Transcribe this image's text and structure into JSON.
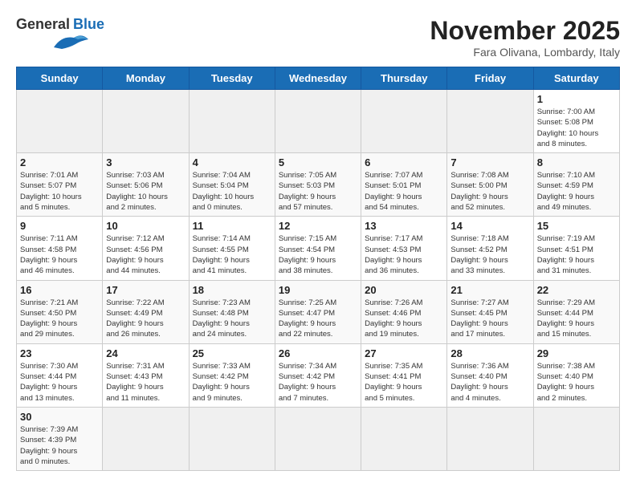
{
  "logo": {
    "text_general": "General",
    "text_blue": "Blue"
  },
  "title": "November 2025",
  "subtitle": "Fara Olivana, Lombardy, Italy",
  "days_of_week": [
    "Sunday",
    "Monday",
    "Tuesday",
    "Wednesday",
    "Thursday",
    "Friday",
    "Saturday"
  ],
  "weeks": [
    [
      {
        "day": "",
        "info": ""
      },
      {
        "day": "",
        "info": ""
      },
      {
        "day": "",
        "info": ""
      },
      {
        "day": "",
        "info": ""
      },
      {
        "day": "",
        "info": ""
      },
      {
        "day": "",
        "info": ""
      },
      {
        "day": "1",
        "info": "Sunrise: 7:00 AM\nSunset: 5:08 PM\nDaylight: 10 hours\nand 8 minutes."
      }
    ],
    [
      {
        "day": "2",
        "info": "Sunrise: 7:01 AM\nSunset: 5:07 PM\nDaylight: 10 hours\nand 5 minutes."
      },
      {
        "day": "3",
        "info": "Sunrise: 7:03 AM\nSunset: 5:06 PM\nDaylight: 10 hours\nand 2 minutes."
      },
      {
        "day": "4",
        "info": "Sunrise: 7:04 AM\nSunset: 5:04 PM\nDaylight: 10 hours\nand 0 minutes."
      },
      {
        "day": "5",
        "info": "Sunrise: 7:05 AM\nSunset: 5:03 PM\nDaylight: 9 hours\nand 57 minutes."
      },
      {
        "day": "6",
        "info": "Sunrise: 7:07 AM\nSunset: 5:01 PM\nDaylight: 9 hours\nand 54 minutes."
      },
      {
        "day": "7",
        "info": "Sunrise: 7:08 AM\nSunset: 5:00 PM\nDaylight: 9 hours\nand 52 minutes."
      },
      {
        "day": "8",
        "info": "Sunrise: 7:10 AM\nSunset: 4:59 PM\nDaylight: 9 hours\nand 49 minutes."
      }
    ],
    [
      {
        "day": "9",
        "info": "Sunrise: 7:11 AM\nSunset: 4:58 PM\nDaylight: 9 hours\nand 46 minutes."
      },
      {
        "day": "10",
        "info": "Sunrise: 7:12 AM\nSunset: 4:56 PM\nDaylight: 9 hours\nand 44 minutes."
      },
      {
        "day": "11",
        "info": "Sunrise: 7:14 AM\nSunset: 4:55 PM\nDaylight: 9 hours\nand 41 minutes."
      },
      {
        "day": "12",
        "info": "Sunrise: 7:15 AM\nSunset: 4:54 PM\nDaylight: 9 hours\nand 38 minutes."
      },
      {
        "day": "13",
        "info": "Sunrise: 7:17 AM\nSunset: 4:53 PM\nDaylight: 9 hours\nand 36 minutes."
      },
      {
        "day": "14",
        "info": "Sunrise: 7:18 AM\nSunset: 4:52 PM\nDaylight: 9 hours\nand 33 minutes."
      },
      {
        "day": "15",
        "info": "Sunrise: 7:19 AM\nSunset: 4:51 PM\nDaylight: 9 hours\nand 31 minutes."
      }
    ],
    [
      {
        "day": "16",
        "info": "Sunrise: 7:21 AM\nSunset: 4:50 PM\nDaylight: 9 hours\nand 29 minutes."
      },
      {
        "day": "17",
        "info": "Sunrise: 7:22 AM\nSunset: 4:49 PM\nDaylight: 9 hours\nand 26 minutes."
      },
      {
        "day": "18",
        "info": "Sunrise: 7:23 AM\nSunset: 4:48 PM\nDaylight: 9 hours\nand 24 minutes."
      },
      {
        "day": "19",
        "info": "Sunrise: 7:25 AM\nSunset: 4:47 PM\nDaylight: 9 hours\nand 22 minutes."
      },
      {
        "day": "20",
        "info": "Sunrise: 7:26 AM\nSunset: 4:46 PM\nDaylight: 9 hours\nand 19 minutes."
      },
      {
        "day": "21",
        "info": "Sunrise: 7:27 AM\nSunset: 4:45 PM\nDaylight: 9 hours\nand 17 minutes."
      },
      {
        "day": "22",
        "info": "Sunrise: 7:29 AM\nSunset: 4:44 PM\nDaylight: 9 hours\nand 15 minutes."
      }
    ],
    [
      {
        "day": "23",
        "info": "Sunrise: 7:30 AM\nSunset: 4:44 PM\nDaylight: 9 hours\nand 13 minutes."
      },
      {
        "day": "24",
        "info": "Sunrise: 7:31 AM\nSunset: 4:43 PM\nDaylight: 9 hours\nand 11 minutes."
      },
      {
        "day": "25",
        "info": "Sunrise: 7:33 AM\nSunset: 4:42 PM\nDaylight: 9 hours\nand 9 minutes."
      },
      {
        "day": "26",
        "info": "Sunrise: 7:34 AM\nSunset: 4:42 PM\nDaylight: 9 hours\nand 7 minutes."
      },
      {
        "day": "27",
        "info": "Sunrise: 7:35 AM\nSunset: 4:41 PM\nDaylight: 9 hours\nand 5 minutes."
      },
      {
        "day": "28",
        "info": "Sunrise: 7:36 AM\nSunset: 4:40 PM\nDaylight: 9 hours\nand 4 minutes."
      },
      {
        "day": "29",
        "info": "Sunrise: 7:38 AM\nSunset: 4:40 PM\nDaylight: 9 hours\nand 2 minutes."
      }
    ],
    [
      {
        "day": "30",
        "info": "Sunrise: 7:39 AM\nSunset: 4:39 PM\nDaylight: 9 hours\nand 0 minutes."
      },
      {
        "day": "",
        "info": ""
      },
      {
        "day": "",
        "info": ""
      },
      {
        "day": "",
        "info": ""
      },
      {
        "day": "",
        "info": ""
      },
      {
        "day": "",
        "info": ""
      },
      {
        "day": "",
        "info": ""
      }
    ]
  ]
}
